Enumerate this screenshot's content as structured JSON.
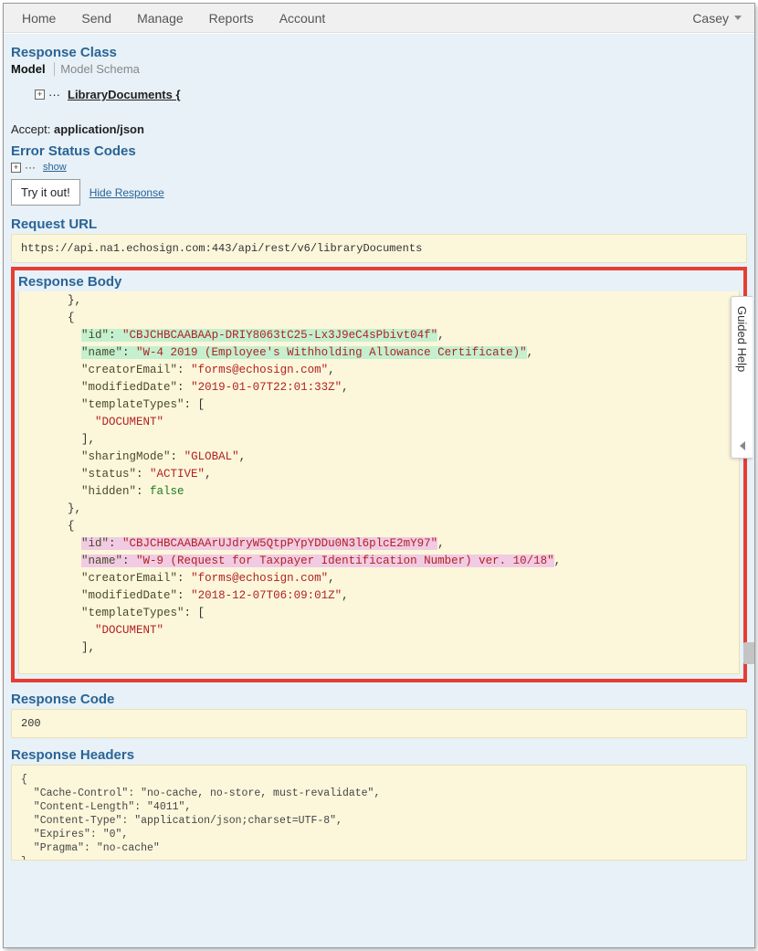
{
  "nav": {
    "items": [
      "Home",
      "Send",
      "Manage",
      "Reports",
      "Account"
    ],
    "user": "Casey"
  },
  "sections": {
    "response_class": "Response Class",
    "model_tab": "Model",
    "model_schema_tab": "Model Schema",
    "library_documents_label": "LibraryDocuments {",
    "accept_label": "Accept:",
    "accept_value": "application/json",
    "error_status_codes": "Error Status Codes",
    "show_link": "show",
    "try_button": "Try it out!",
    "hide_response": "Hide Response",
    "request_url": "Request URL",
    "request_url_value": "https://api.na1.echosign.com:443/api/rest/v6/libraryDocuments",
    "response_body": "Response Body",
    "response_code": "Response Code",
    "response_code_value": "200",
    "response_headers": "Response Headers"
  },
  "response_body_json": [
    {
      "id": "CBJCHBCAABAAp-DRIY8063tC25-Lx3J9eC4sPbivt04f",
      "name": "W-4 2019 (Employee's Withholding Allowance Certificate)",
      "creatorEmail": "forms@echosign.com",
      "modifiedDate": "2019-01-07T22:01:33Z",
      "templateTypes": [
        "DOCUMENT"
      ],
      "sharingMode": "GLOBAL",
      "status": "ACTIVE",
      "hidden": false
    },
    {
      "id": "CBJCHBCAABAArUJdryW5QtpPYpYDDu0N3l6plcE2mY97",
      "name": "W-9 (Request for Taxpayer Identification Number) ver. 10/18",
      "creatorEmail": "forms@echosign.com",
      "modifiedDate": "2018-12-07T06:09:01Z",
      "templateTypes": [
        "DOCUMENT"
      ]
    }
  ],
  "response_headers_json": {
    "Cache-Control": "no-cache, no-store, must-revalidate",
    "Content-Length": "4011",
    "Content-Type": "application/json;charset=UTF-8",
    "Expires": "0",
    "Pragma": "no-cache"
  },
  "guided_help": "Guided Help"
}
